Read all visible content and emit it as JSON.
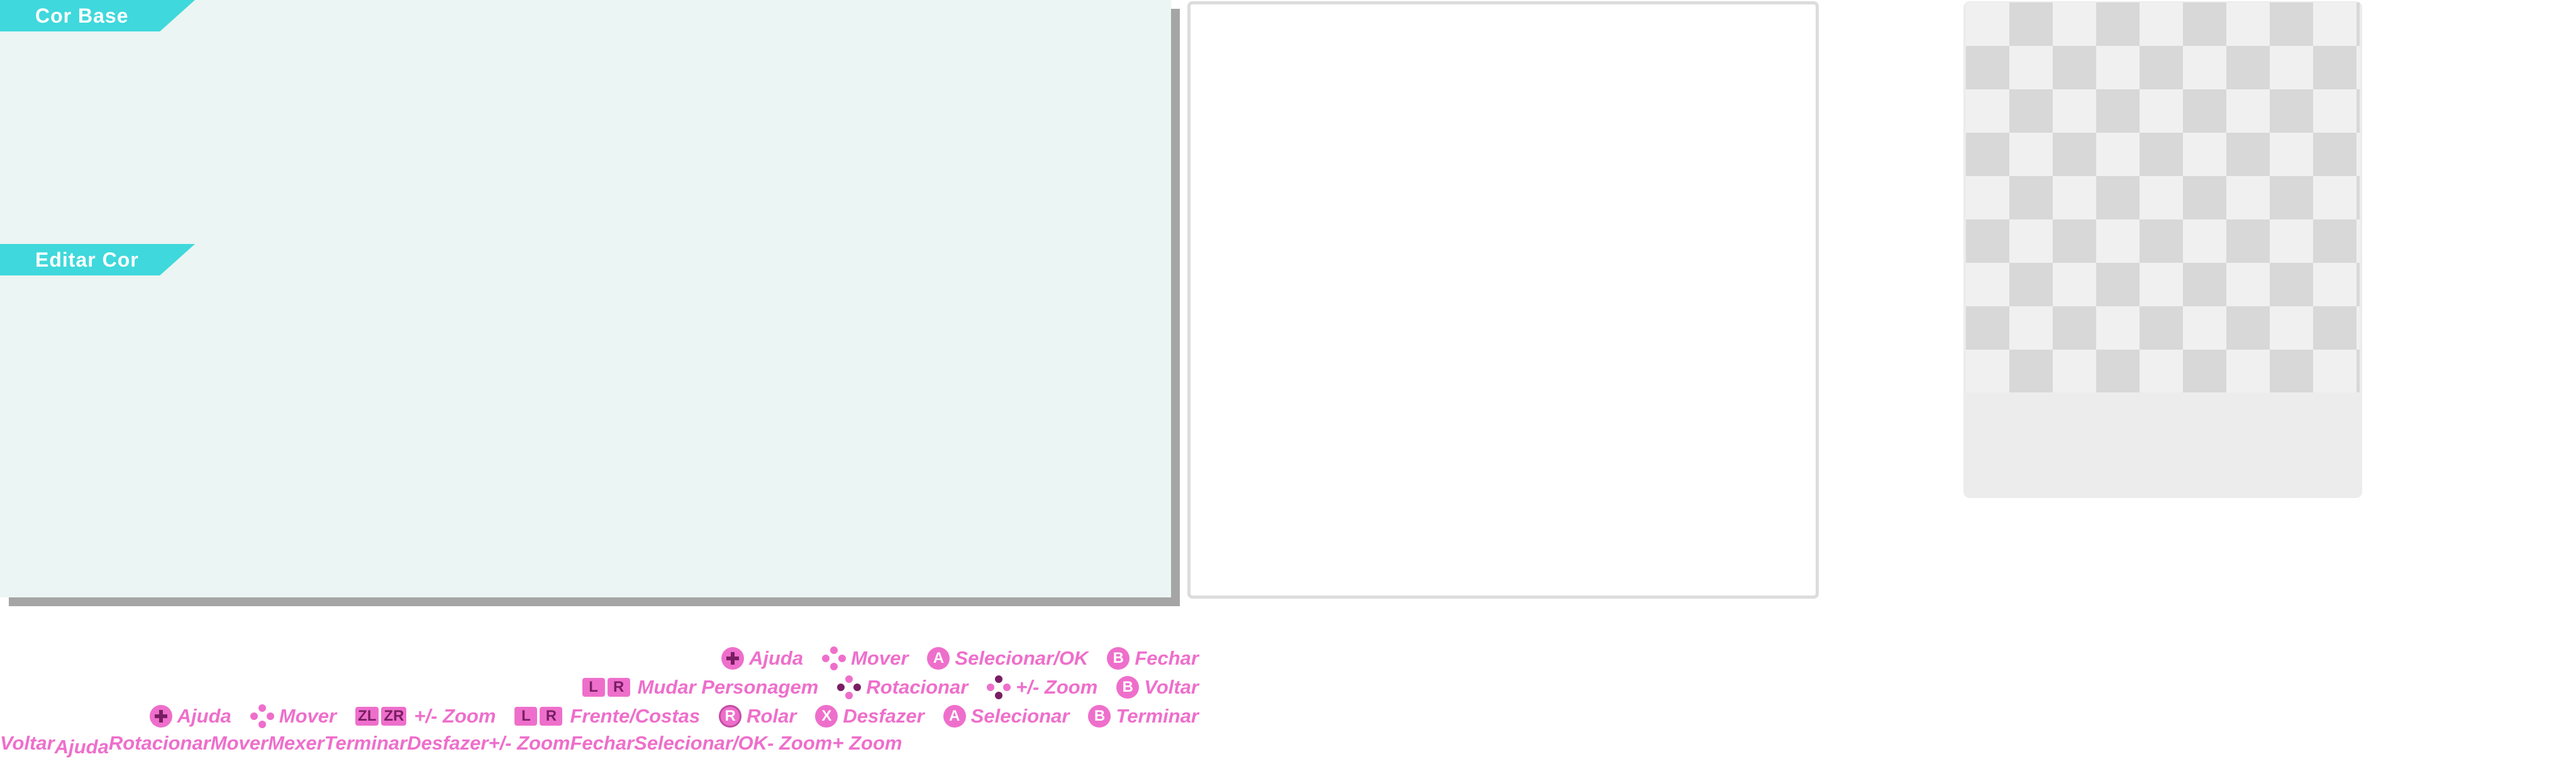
{
  "sections": {
    "base_color": "Cor Base",
    "edit_color": "Editar Cor"
  },
  "hints": {
    "row1": [
      {
        "icon": "plus-button-icon",
        "label": "Ajuda"
      },
      {
        "icon": "dpad-icon",
        "label": "Mover"
      },
      {
        "icon": "a-button-icon",
        "glyph": "A",
        "label": "Selecionar/OK"
      },
      {
        "icon": "b-button-icon",
        "glyph": "B",
        "label": "Fechar"
      }
    ],
    "row2": [
      {
        "icon": "lr-buttons-icon",
        "glyphs": [
          "L",
          "R"
        ],
        "label": "Mudar Personagem"
      },
      {
        "icon": "dpad-icon",
        "label": "Rotacionar"
      },
      {
        "icon": "dpad-icon",
        "label": "+/- Zoom"
      },
      {
        "icon": "b-button-icon",
        "glyph": "B",
        "label": "Voltar"
      }
    ],
    "row3": [
      {
        "icon": "plus-button-icon",
        "label": "Ajuda"
      },
      {
        "icon": "dpad-icon",
        "label": "Mover"
      },
      {
        "icon": "zl-zr-buttons-icon",
        "glyphs": [
          "ZL",
          "ZR"
        ],
        "label": "+/- Zoom"
      },
      {
        "icon": "lr-buttons-icon",
        "glyphs": [
          "L",
          "R"
        ],
        "label": "Frente/Costas"
      },
      {
        "icon": "r-stick-icon",
        "glyph": "R",
        "label": "Rolar"
      },
      {
        "icon": "x-button-icon",
        "glyph": "X",
        "label": "Desfazer"
      },
      {
        "icon": "a-button-icon",
        "glyph": "A",
        "label": "Selecionar"
      },
      {
        "icon": "b-button-icon",
        "glyph": "B",
        "label": "Terminar"
      }
    ],
    "row4": [
      "Voltar",
      "Ajuda",
      "Rotacionar",
      "Mover",
      "Mexer",
      "Terminar",
      "Desfazer",
      "+/- Zoom",
      "Fechar",
      "Selecionar/OK",
      "- Zoom",
      "+ Zoom"
    ]
  },
  "colors": {
    "accent_tab": "#3fd8dc",
    "panel_bg": "#ebf5f3",
    "hint_pink": "#ee6fcb"
  }
}
